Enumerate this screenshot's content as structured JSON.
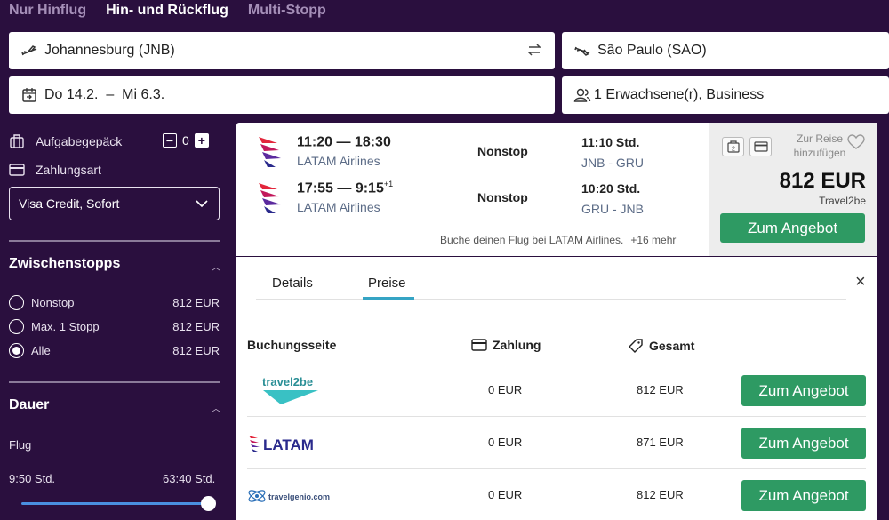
{
  "trip_tabs": [
    "Nur Hinflug",
    "Hin- und Rückflug",
    "Multi-Stopp"
  ],
  "search": {
    "origin": "Johannesburg (JNB)",
    "destination": "São Paulo (SAO)",
    "dates": "Do 14.2.  –  Mi 6.3.",
    "passengers": "1 Erwachsene(r), Business"
  },
  "sidebar": {
    "baggage_label": "Aufgabegepäck",
    "baggage_count": "0",
    "payment_label": "Zahlungsart",
    "payment_value": "Visa Credit, Sofort",
    "stops_title": "Zwischenstopps",
    "stops": [
      {
        "label": "Nonstop",
        "price": "812 EUR",
        "selected": false
      },
      {
        "label": "Max. 1 Stopp",
        "price": "812 EUR",
        "selected": false
      },
      {
        "label": "Alle",
        "price": "812 EUR",
        "selected": true
      }
    ],
    "duration_title": "Dauer",
    "flight_label": "Flug",
    "duration_min": "9:50 Std.",
    "duration_max": "63:40 Std."
  },
  "result": {
    "legs": [
      {
        "times": "11:20 — 18:30",
        "day_offset": "",
        "airline": "LATAM Airlines",
        "stops": "Nonstop",
        "duration": "11:10 Std.",
        "route": "JNB - GRU"
      },
      {
        "times": "17:55 — 9:15",
        "day_offset": "+1",
        "airline": "LATAM Airlines",
        "stops": "Nonstop",
        "duration": "10:20 Std.",
        "route": "GRU - JNB"
      }
    ],
    "book_note": "Buche deinen Flug bei LATAM Airlines.",
    "more": "+16 mehr",
    "fav_label": "Zur Reise hinzufügen",
    "price": "812 EUR",
    "seller": "Travel2be",
    "cta": "Zum Angebot"
  },
  "details": {
    "tabs": [
      "Details",
      "Preise"
    ],
    "active_tab": "Preise",
    "columns": {
      "site": "Buchungsseite",
      "payment": "Zahlung",
      "total": "Gesamt"
    },
    "rows": [
      {
        "site": "travel2be",
        "payment": "0 EUR",
        "total": "812 EUR",
        "cta": "Zum Angebot"
      },
      {
        "site": "LATAM",
        "payment": "0 EUR",
        "total": "871 EUR",
        "cta": "Zum Angebot"
      },
      {
        "site": "travelgenio.com",
        "payment": "0 EUR",
        "total": "812 EUR",
        "cta": "Zum Angebot"
      }
    ]
  },
  "colors": {
    "background": "#2a0f3e",
    "cta": "#2e9a63",
    "tab_accent": "#35a4c4",
    "latam_red": "#e3263c",
    "latam_indigo": "#2a2a8c"
  }
}
